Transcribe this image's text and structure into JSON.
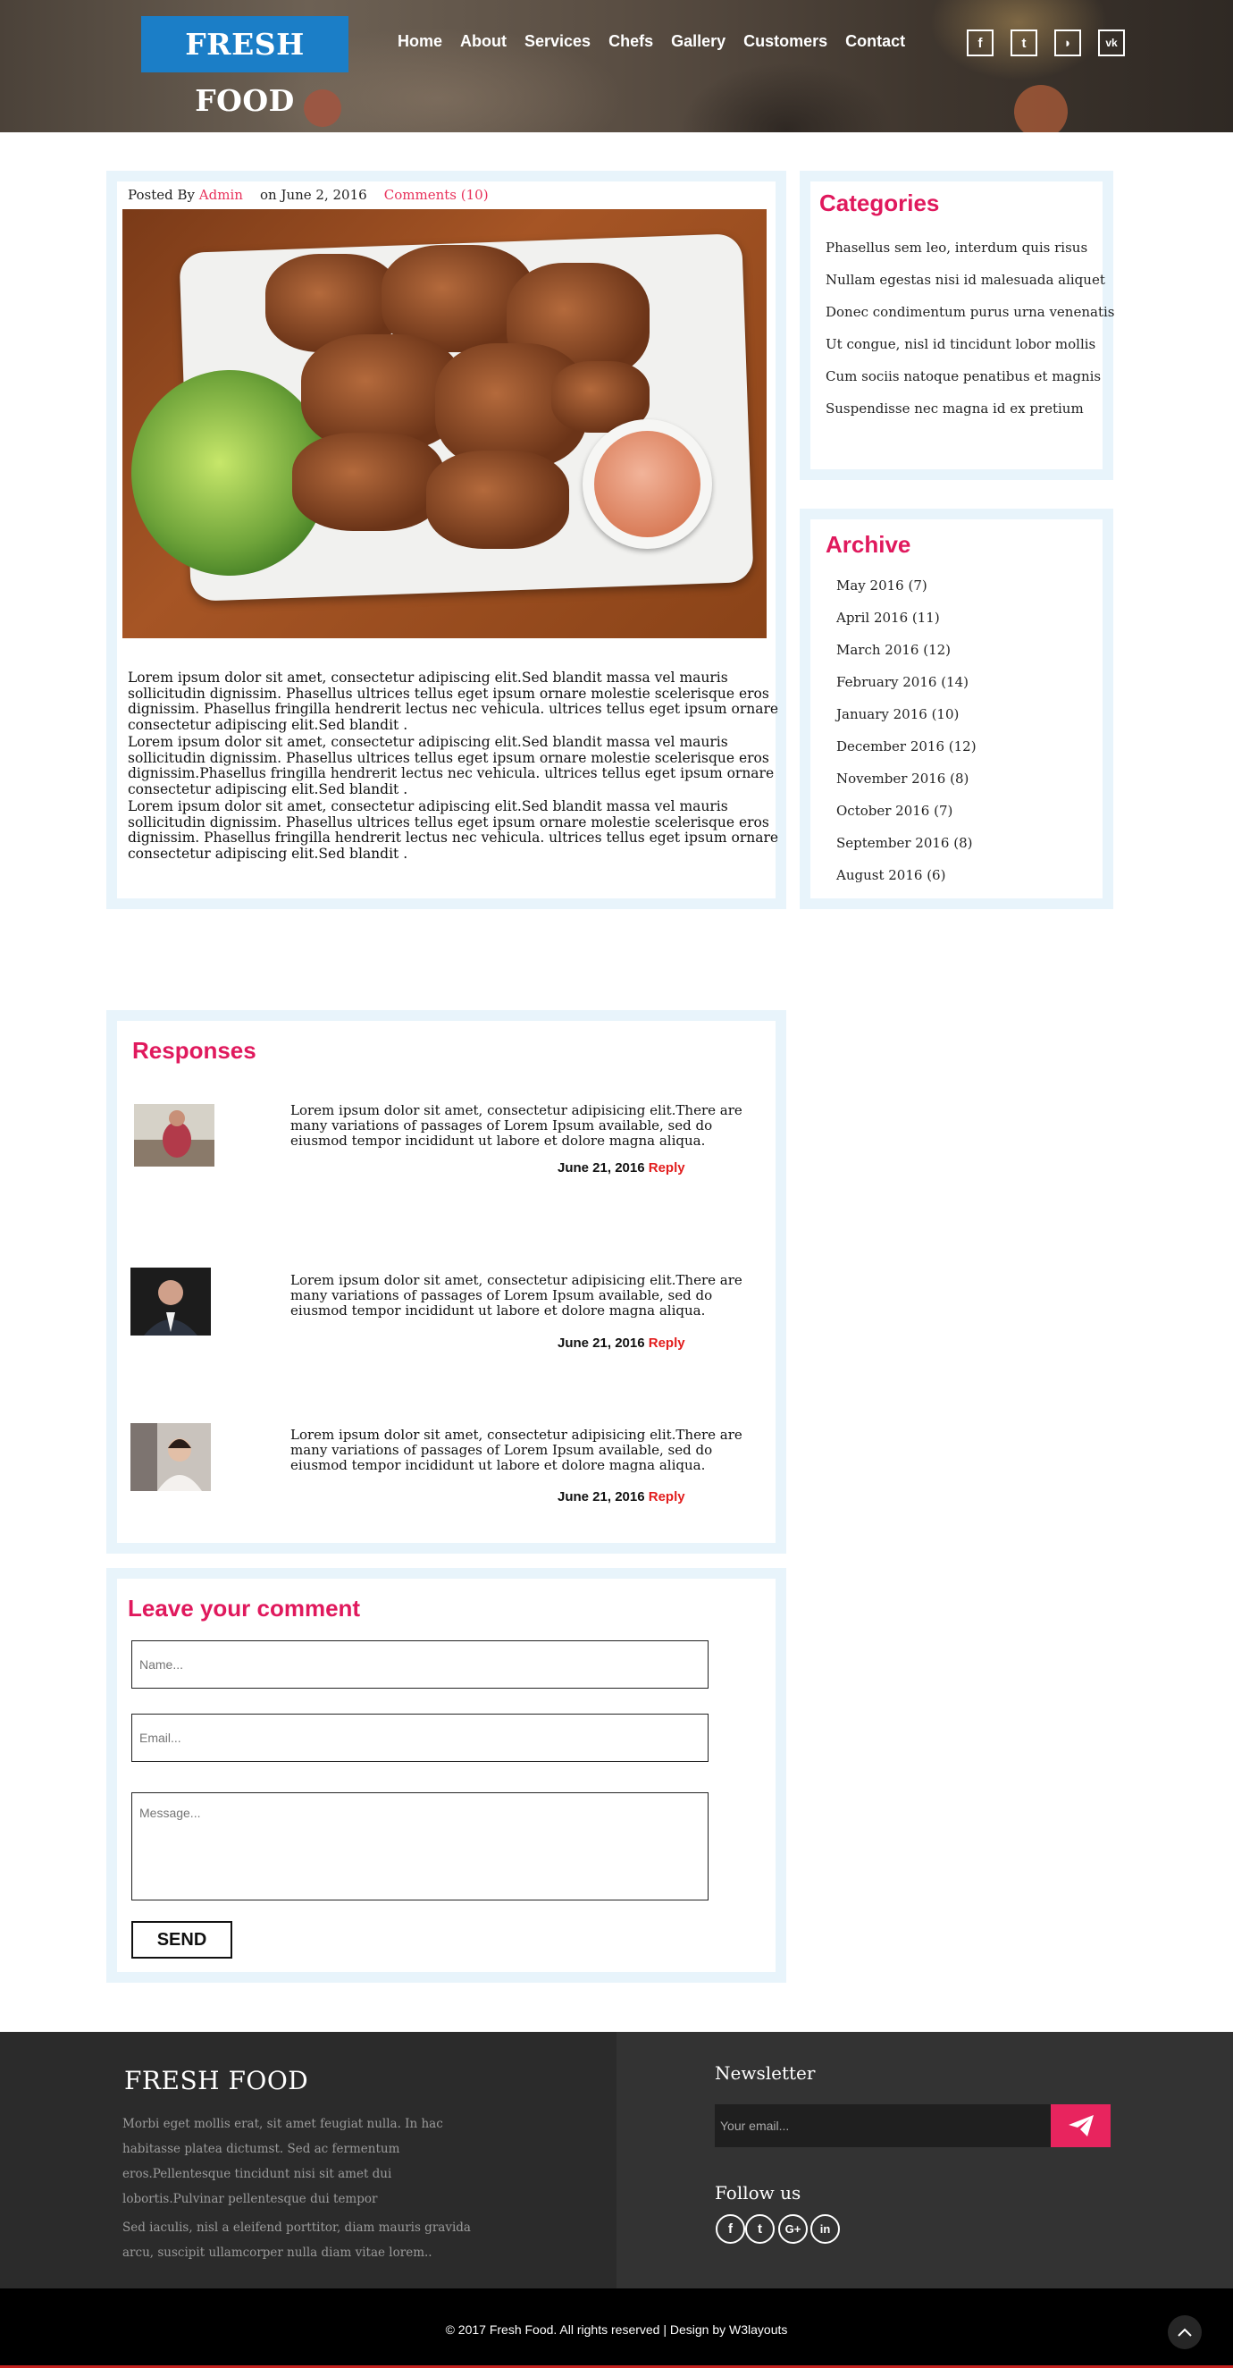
{
  "header": {
    "logo": "FRESH FOOD",
    "nav": [
      "Home",
      "About",
      "Services",
      "Chefs",
      "Gallery",
      "Customers",
      "Contact"
    ],
    "social_icons": [
      "facebook-icon",
      "twitter-icon",
      "rss-icon",
      "vk-icon"
    ],
    "social_glyphs": [
      "f",
      "t",
      "◗",
      "vk"
    ]
  },
  "post": {
    "posted_by_label": "Posted By",
    "author": "Admin",
    "date": "on June 2, 2016",
    "comments": "Comments (10)",
    "paragraphs": [
      "Lorem ipsum dolor sit amet, consectetur adipiscing elit.Sed blandit massa vel mauris sollicitudin dignissim. Phasellus ultrices tellus eget ipsum ornare molestie scelerisque eros dignissim. Phasellus fringilla hendrerit lectus nec vehicula. ultrices tellus eget ipsum ornare consectetur adipiscing elit.Sed blandit .",
      "Lorem ipsum dolor sit amet, consectetur adipiscing elit.Sed blandit massa vel mauris sollicitudin dignissim. Phasellus ultrices tellus eget ipsum ornare molestie scelerisque eros dignissim.Phasellus fringilla hendrerit lectus nec vehicula. ultrices tellus eget ipsum ornare consectetur adipiscing elit.Sed blandit .",
      "Lorem ipsum dolor sit amet, consectetur adipiscing elit.Sed blandit massa vel mauris sollicitudin dignissim. Phasellus ultrices tellus eget ipsum ornare molestie scelerisque eros dignissim. Phasellus fringilla hendrerit lectus nec vehicula. ultrices tellus eget ipsum ornare consectetur adipiscing elit.Sed blandit ."
    ]
  },
  "categories": {
    "title": "Categories",
    "items": [
      "Phasellus sem leo, interdum quis risus",
      "Nullam egestas nisi id malesuada aliquet",
      "Donec condimentum purus urna venenatis",
      "Ut congue, nisl id tincidunt lobor mollis",
      "Cum sociis natoque penatibus et magnis",
      "Suspendisse nec magna id ex pretium"
    ]
  },
  "archive": {
    "title": "Archive",
    "items": [
      "May 2016 (7)",
      "April 2016 (11)",
      "March 2016 (12)",
      "February 2016 (14)",
      "January 2016 (10)",
      "December 2016 (12)",
      "November 2016 (8)",
      "October 2016 (7)",
      "September 2016 (8)",
      "August 2016 (6)"
    ]
  },
  "responses": {
    "title": "Responses",
    "items": [
      {
        "text": "Lorem ipsum dolor sit amet, consectetur adipisicing elit.There are many variations of passages of Lorem Ipsum available, sed do eiusmod tempor incididunt ut labore et dolore magna aliqua.",
        "date": "June 21, 2016",
        "reply": "Reply"
      },
      {
        "text": "Lorem ipsum dolor sit amet, consectetur adipisicing elit.There are many variations of passages of Lorem Ipsum available, sed do eiusmod tempor incididunt ut labore et dolore magna aliqua.",
        "date": "June 21, 2016",
        "reply": "Reply"
      },
      {
        "text": "Lorem ipsum dolor sit amet, consectetur adipisicing elit.There are many variations of passages of Lorem Ipsum available, sed do eiusmod tempor incididunt ut labore et dolore magna aliqua.",
        "date": "June 21, 2016",
        "reply": "Reply"
      }
    ]
  },
  "comment_form": {
    "title": "Leave your comment",
    "name_placeholder": "Name...",
    "email_placeholder": "Email...",
    "message_placeholder": "Message...",
    "send_label": "SEND"
  },
  "footer": {
    "title": "FRESH FOOD",
    "para1": "Morbi eget mollis erat, sit amet feugiat nulla. In hac habitasse platea dictumst. Sed ac fermentum eros.Pellentesque tincidunt nisi sit amet dui lobortis.Pulvinar pellentesque dui tempor",
    "para2": "Sed iaculis, nisl a eleifend porttitor, diam mauris gravida arcu, suscipit ullamcorper nulla diam vitae lorem..",
    "newsletter_title": "Newsletter",
    "newsletter_placeholder": "Your email...",
    "follow_title": "Follow us",
    "follow_icons": [
      "facebook-icon",
      "twitter-icon",
      "google-plus-icon",
      "linkedin-icon"
    ],
    "follow_glyphs": [
      "f",
      "t",
      "G+",
      "in"
    ],
    "copyright": "© 2017 Fresh Food. All rights reserved | Design by W3layouts"
  },
  "colors": {
    "accent_pink": "#e0195d",
    "logo_blue": "#1b7ec7",
    "panel_border": "#e8f4fb",
    "reply_red": "#e21d1d"
  }
}
